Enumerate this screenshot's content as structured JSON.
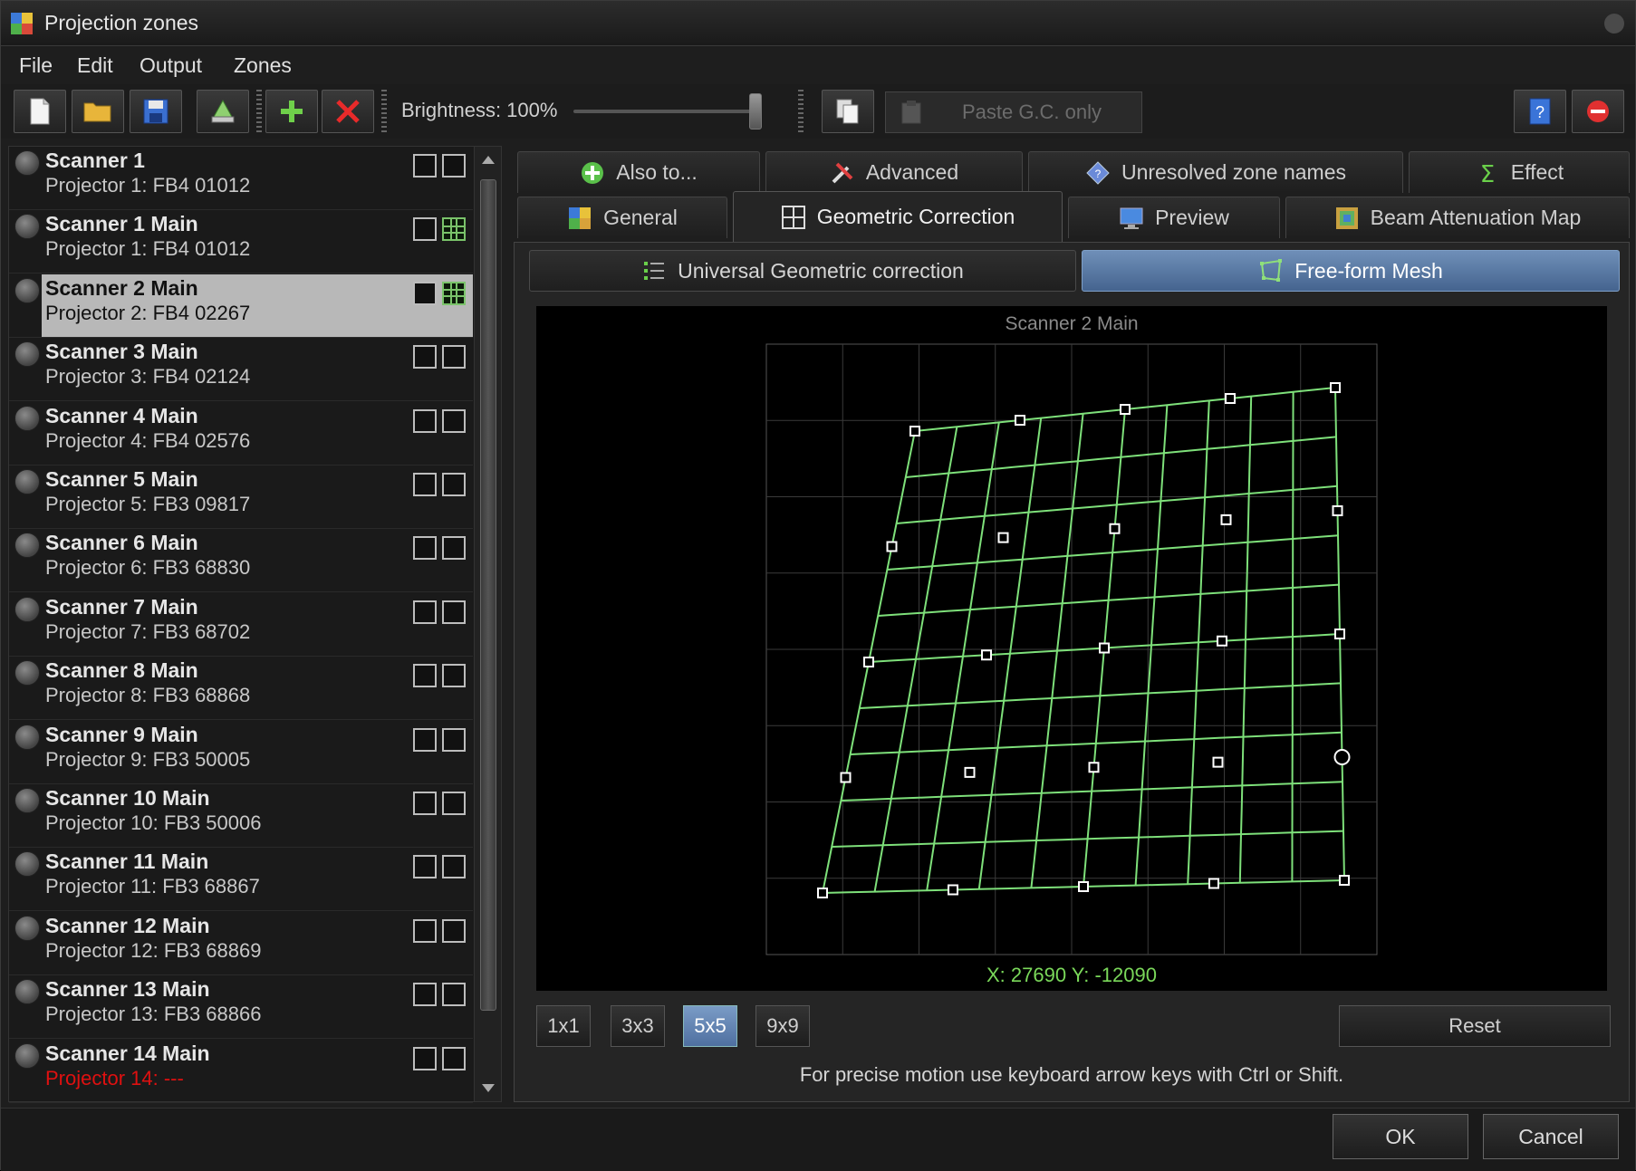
{
  "window": {
    "title": "Projection zones"
  },
  "menu": [
    "File",
    "Edit",
    "Output",
    "Zones"
  ],
  "toolbar": {
    "brightness_label": "Brightness: 100%",
    "brightness_value": 1.0,
    "paste_label": "Paste G.C. only"
  },
  "scanners": [
    {
      "name": "Scanner 1",
      "projector": "Projector 1: FB4 01012",
      "selected": false,
      "mesh": false,
      "error": false
    },
    {
      "name": "Scanner 1 Main",
      "projector": "Projector 1: FB4 01012",
      "selected": false,
      "mesh": true,
      "error": false
    },
    {
      "name": "Scanner 2 Main",
      "projector": "Projector 2: FB4 02267",
      "selected": true,
      "mesh": true,
      "error": false
    },
    {
      "name": "Scanner 3 Main",
      "projector": "Projector 3: FB4 02124",
      "selected": false,
      "mesh": false,
      "error": false
    },
    {
      "name": "Scanner 4 Main",
      "projector": "Projector 4: FB4 02576",
      "selected": false,
      "mesh": false,
      "error": false
    },
    {
      "name": "Scanner 5 Main",
      "projector": "Projector 5: FB3 09817",
      "selected": false,
      "mesh": false,
      "error": false
    },
    {
      "name": "Scanner 6 Main",
      "projector": "Projector 6: FB3 68830",
      "selected": false,
      "mesh": false,
      "error": false
    },
    {
      "name": "Scanner 7 Main",
      "projector": "Projector 7: FB3 68702",
      "selected": false,
      "mesh": false,
      "error": false
    },
    {
      "name": "Scanner 8 Main",
      "projector": "Projector 8: FB3 68868",
      "selected": false,
      "mesh": false,
      "error": false
    },
    {
      "name": "Scanner 9 Main",
      "projector": "Projector 9: FB3 50005",
      "selected": false,
      "mesh": false,
      "error": false
    },
    {
      "name": "Scanner 10 Main",
      "projector": "Projector 10: FB3 50006",
      "selected": false,
      "mesh": false,
      "error": false
    },
    {
      "name": "Scanner 11 Main",
      "projector": "Projector 11: FB3 68867",
      "selected": false,
      "mesh": false,
      "error": false
    },
    {
      "name": "Scanner 12 Main",
      "projector": "Projector 12: FB3 68869",
      "selected": false,
      "mesh": false,
      "error": false
    },
    {
      "name": "Scanner 13 Main",
      "projector": "Projector 13: FB3 68866",
      "selected": false,
      "mesh": false,
      "error": false
    },
    {
      "name": "Scanner 14 Main",
      "projector": "Projector 14: ---",
      "selected": false,
      "mesh": false,
      "error": true
    }
  ],
  "tabs_row1": [
    "Also to...",
    "Advanced",
    "Unresolved zone names",
    "Effect"
  ],
  "tabs_row2": [
    "General",
    "Geometric Correction",
    "Preview",
    "Beam Attenuation Map"
  ],
  "active_tab": "Geometric Correction",
  "subtabs": [
    "Universal Geometric correction",
    "Free-form Mesh"
  ],
  "active_subtab": "Free-form Mesh",
  "canvas": {
    "title": "Scanner 2 Main",
    "coords": "X: 27690  Y: -12090"
  },
  "grid_buttons": [
    "1x1",
    "3x3",
    "5x5",
    "9x9"
  ],
  "active_grid": "5x5",
  "reset_label": "Reset",
  "hint": "For precise motion use keyboard arrow keys with Ctrl or Shift.",
  "ok_label": "OK",
  "cancel_label": "Cancel",
  "colors": {
    "mesh_line": "#7ee07a",
    "grid_line": "#3a3a3a",
    "active_blue": "#5a7aa8",
    "error_red": "#e01010"
  }
}
